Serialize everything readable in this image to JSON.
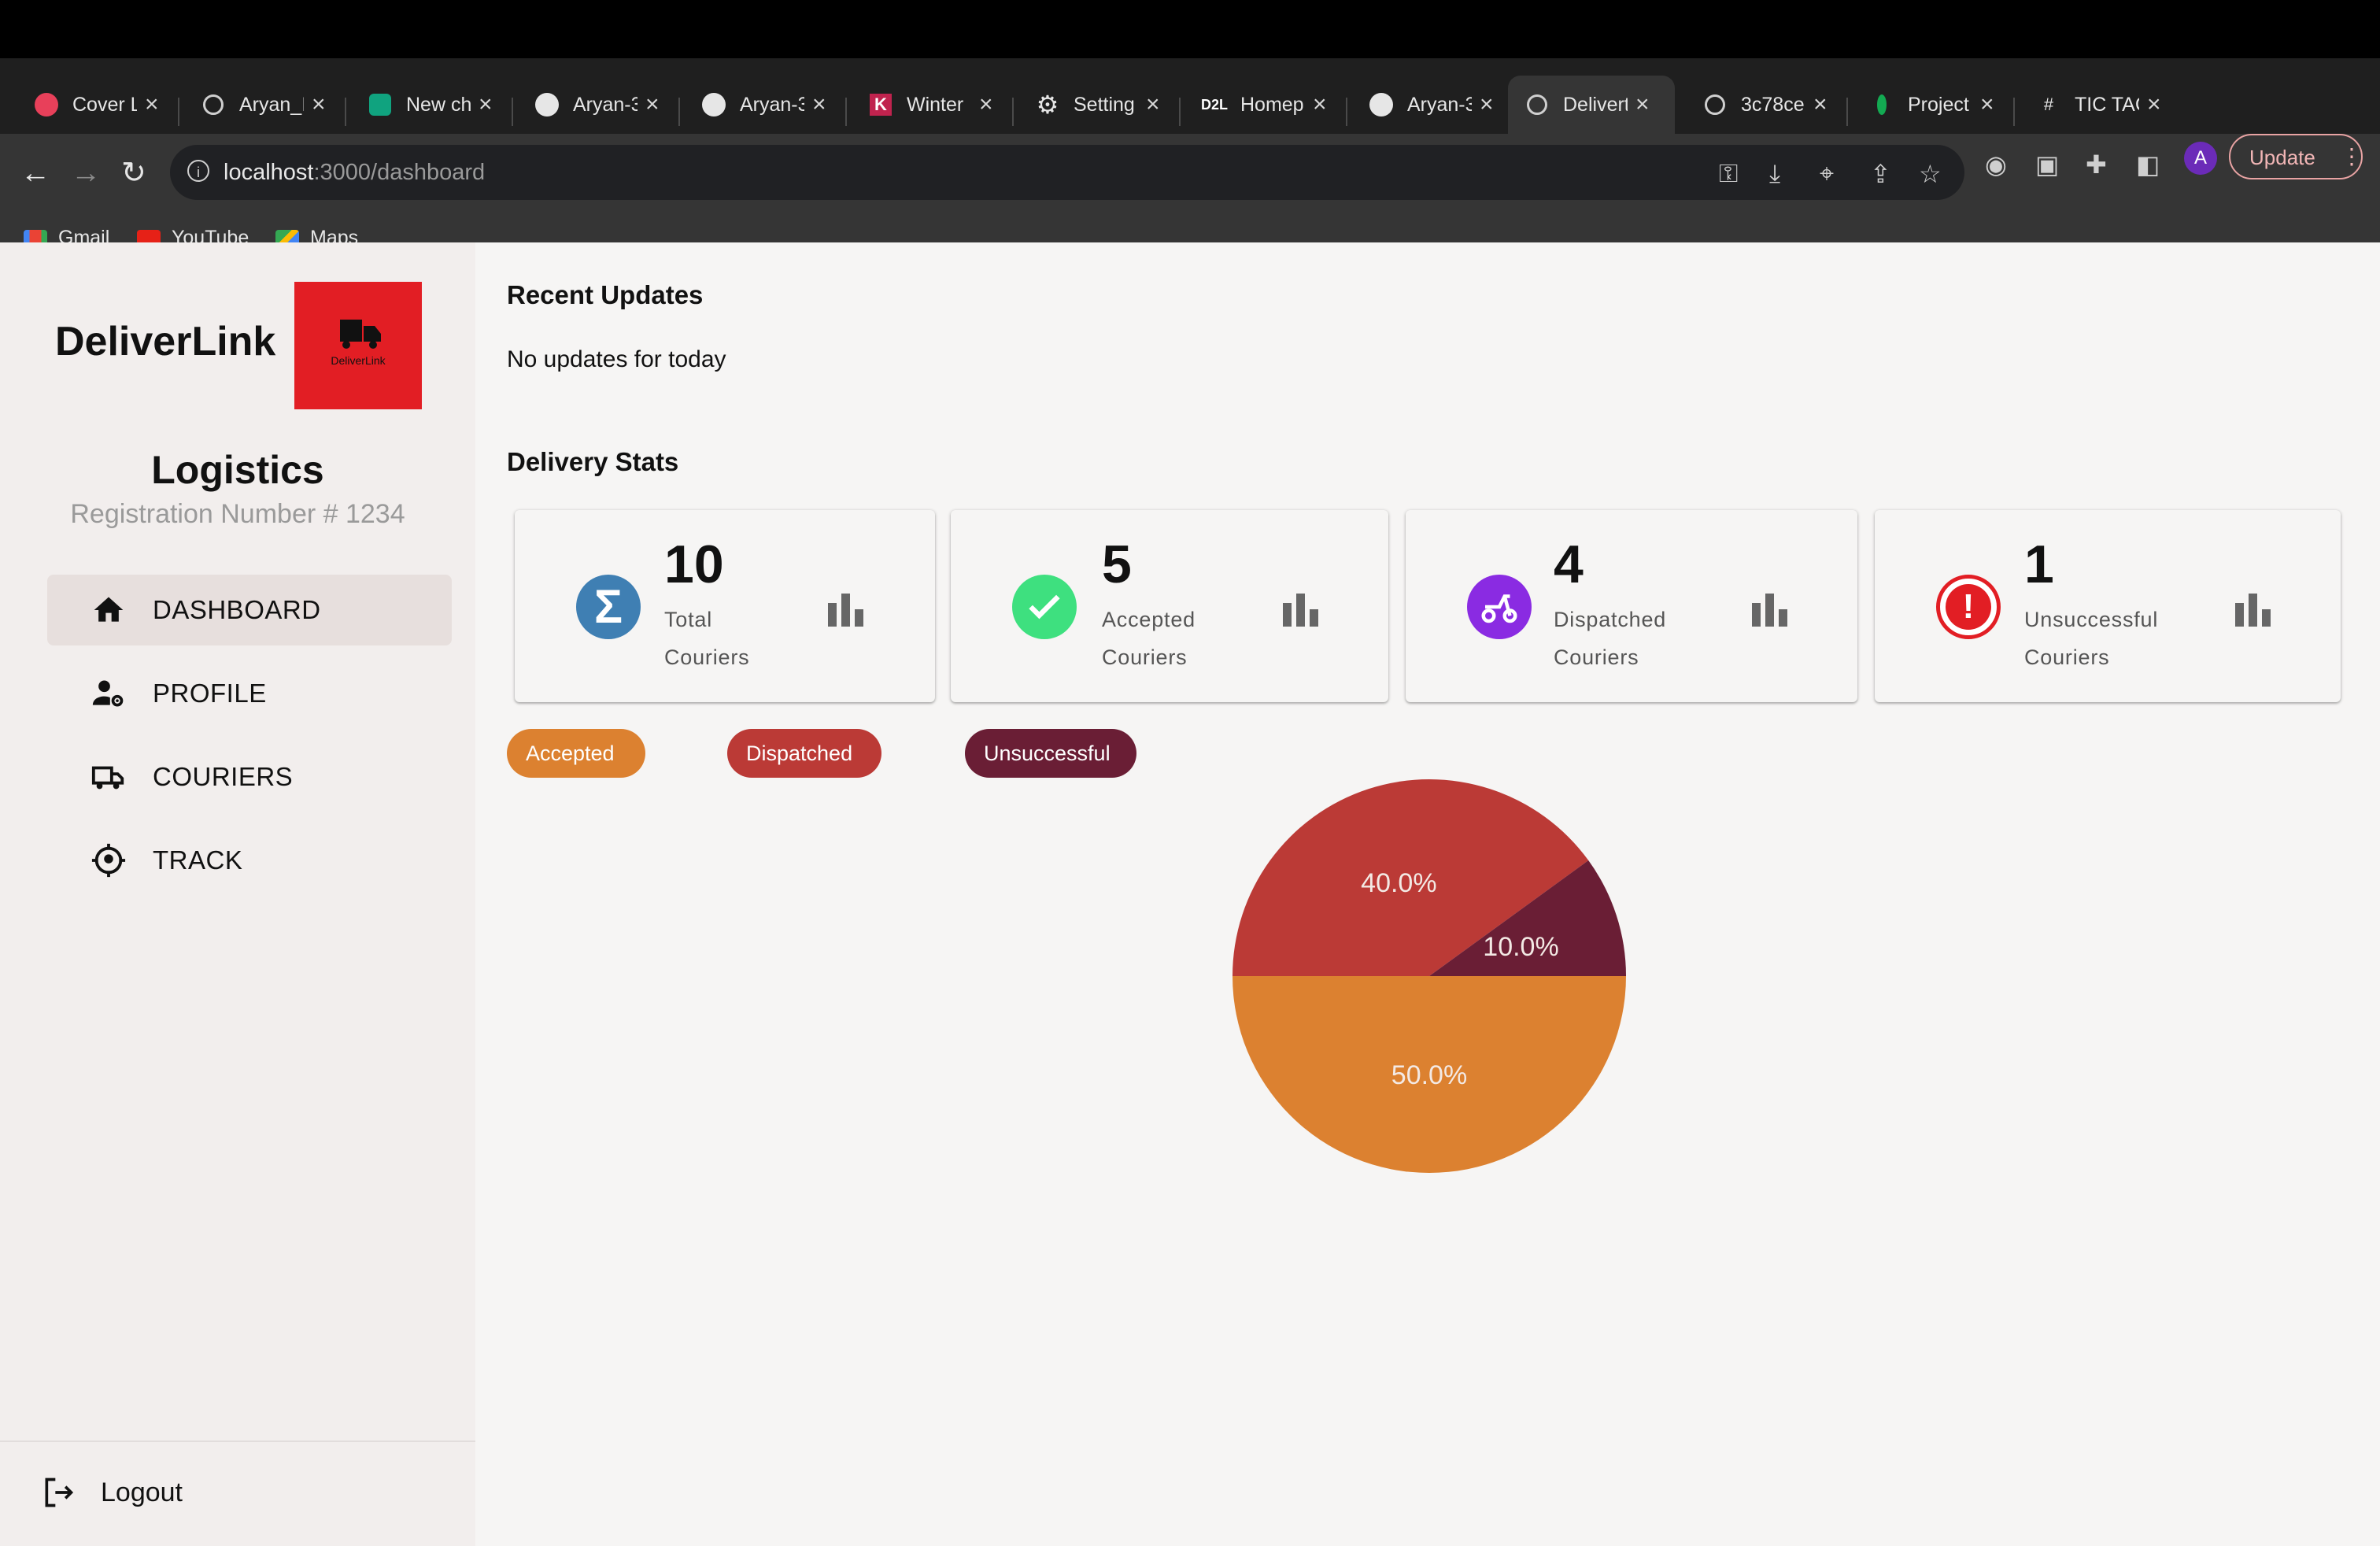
{
  "browser": {
    "tabs": [
      {
        "label": "Cover L",
        "icon": "red-circle-icon"
      },
      {
        "label": "Aryan_I",
        "icon": "globe-icon"
      },
      {
        "label": "New ch",
        "icon": "chatgpt-icon"
      },
      {
        "label": "Aryan-3",
        "icon": "github-icon"
      },
      {
        "label": "Aryan-3",
        "icon": "github-icon"
      },
      {
        "label": "Winter",
        "icon": "k-logo-icon"
      },
      {
        "label": "Setting",
        "icon": "gear-icon"
      },
      {
        "label": "Homep",
        "icon": "d2l-icon"
      },
      {
        "label": "Aryan-3",
        "icon": "github-icon"
      },
      {
        "label": "Delivert",
        "icon": "globe-icon",
        "active": true
      },
      {
        "label": "3c78ce",
        "icon": "globe-icon"
      },
      {
        "label": "Project",
        "icon": "mongodb-leaf-icon"
      },
      {
        "label": "TIC TAC",
        "icon": "tic-tac-toe-icon"
      }
    ],
    "url_host": "localhost",
    "url_path": ":3000/dashboard",
    "update_label": "Update",
    "avatar_letter": "A",
    "bookmarks": [
      {
        "label": "Gmail"
      },
      {
        "label": "YouTube"
      },
      {
        "label": "Maps"
      }
    ]
  },
  "sidebar": {
    "brand": "DeliverLink",
    "logo_caption": "DeliverLink",
    "org_name": "Logistics",
    "registration": "Registration Number # 1234",
    "nav": [
      {
        "label": "DASHBOARD",
        "icon": "home-icon",
        "active": true
      },
      {
        "label": "PROFILE",
        "icon": "user-settings-icon"
      },
      {
        "label": "COURIERS",
        "icon": "truck-icon"
      },
      {
        "label": "TRACK",
        "icon": "location-target-icon"
      }
    ],
    "logout_label": "Logout"
  },
  "main": {
    "recent_title": "Recent Updates",
    "recent_text": "No updates for today",
    "stats_title": "Delivery Stats",
    "cards": [
      {
        "value": "10",
        "line1": "Total",
        "line2": "Couriers",
        "icon": "sigma-icon",
        "color": "#3f7fb3"
      },
      {
        "value": "5",
        "line1": "Accepted",
        "line2": "Couriers",
        "icon": "check-icon",
        "color": "#3ee07f"
      },
      {
        "value": "4",
        "line1": "Dispatched",
        "line2": "Couriers",
        "icon": "scooter-icon",
        "color": "#8a2be2"
      },
      {
        "value": "1",
        "line1": "Unsuccessful",
        "line2": "Couriers",
        "icon": "alert-icon",
        "color": "#e21e24"
      }
    ]
  },
  "chart_data": {
    "type": "pie",
    "categories": [
      "Accepted",
      "Dispatched",
      "Unsuccessful"
    ],
    "values": [
      5,
      4,
      1
    ],
    "labels": [
      "50.0%",
      "40.0%",
      "10.0%"
    ],
    "colors": [
      "#dc8130",
      "#bb3a36",
      "#6a1e35"
    ],
    "legend": "top-left"
  }
}
